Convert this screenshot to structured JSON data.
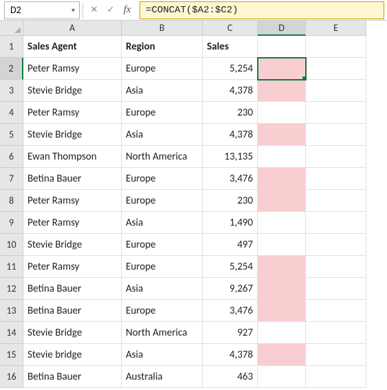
{
  "nameBox": "D2",
  "formula": "=CONCAT($A2:$C2)",
  "columns": [
    "A",
    "B",
    "C",
    "D",
    "E"
  ],
  "colWidths": {
    "A": 143,
    "B": 118,
    "C": 80,
    "D": 70,
    "E": 88
  },
  "activeCol": "D",
  "activeRow": 2,
  "headers": {
    "A": "Sales Agent",
    "B": "Region",
    "C": "Sales"
  },
  "rows": [
    {
      "n": 2,
      "A": "Peter Ramsy",
      "B": "Europe",
      "C": "5,254",
      "pink": true,
      "active": true
    },
    {
      "n": 3,
      "A": "Stevie Bridge",
      "B": "Asia",
      "C": "4,378",
      "pink": true
    },
    {
      "n": 4,
      "A": "Peter Ramsy",
      "B": "Europe",
      "C": "230",
      "pink": false
    },
    {
      "n": 5,
      "A": "Stevie Bridge",
      "B": "Asia",
      "C": "4,378",
      "pink": true
    },
    {
      "n": 6,
      "A": "Ewan Thompson",
      "B": "North America",
      "C": "13,135",
      "pink": false
    },
    {
      "n": 7,
      "A": "Betina Bauer",
      "B": "Europe",
      "C": "3,476",
      "pink": true
    },
    {
      "n": 8,
      "A": "Peter Ramsy",
      "B": "Europe",
      "C": "230",
      "pink": true
    },
    {
      "n": 9,
      "A": "Peter Ramsy",
      "B": "Asia",
      "C": "1,490",
      "pink": false
    },
    {
      "n": 10,
      "A": "Stevie Bridge",
      "B": "Europe",
      "C": "497",
      "pink": false
    },
    {
      "n": 11,
      "A": "Peter Ramsy",
      "B": "Europe",
      "C": "5,254",
      "pink": true
    },
    {
      "n": 12,
      "A": "Betina Bauer",
      "B": "Asia",
      "C": "9,267",
      "pink": true
    },
    {
      "n": 13,
      "A": "Betina Bauer",
      "B": "Europe",
      "C": "3,476",
      "pink": true
    },
    {
      "n": 14,
      "A": "Stevie Bridge",
      "B": "North America",
      "C": "927",
      "pink": false
    },
    {
      "n": 15,
      "A": "Stevie bridge",
      "B": "Asia",
      "C": "4,378",
      "pink": true
    },
    {
      "n": 16,
      "A": "Betina Bauer",
      "B": "Australia",
      "C": "463",
      "pink": false
    }
  ],
  "icons": {
    "dropdown": "▾",
    "cancel": "✕",
    "confirm": "✓",
    "fx": "fx"
  }
}
